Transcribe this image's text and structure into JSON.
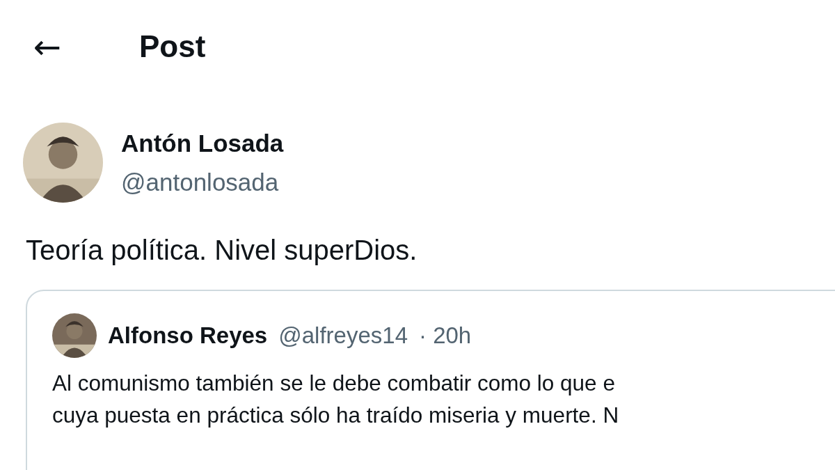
{
  "header": {
    "back_icon": "←",
    "title": "Post"
  },
  "post": {
    "author": {
      "name": "Antón Losada",
      "handle": "@antonlosada"
    },
    "text": "Teoría política. Nivel superDios.",
    "quote": {
      "author": {
        "name": "Alfonso Reyes",
        "handle": "@alfreyes14",
        "time": "· 20h"
      },
      "lines": [
        "Al comunismo también se le debe combatir como lo que e",
        "cuya puesta en práctica sólo ha traído miseria y muerte. N"
      ]
    }
  }
}
